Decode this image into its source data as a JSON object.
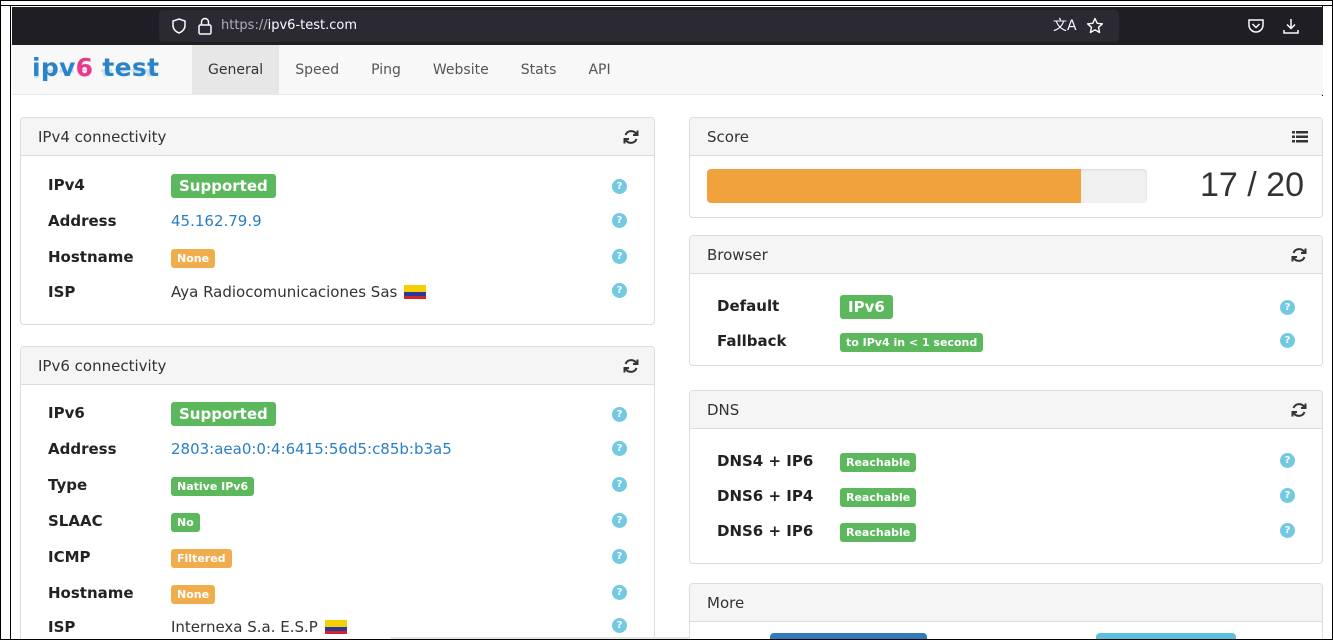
{
  "browser": {
    "url_scheme": "https://",
    "url_host": "ipv6-test.com"
  },
  "logo": {
    "part1": "ipv",
    "part2": "6",
    "part3": " test"
  },
  "nav": {
    "tabs": [
      {
        "label": "General"
      },
      {
        "label": "Speed"
      },
      {
        "label": "Ping"
      },
      {
        "label": "Website"
      },
      {
        "label": "Stats"
      },
      {
        "label": "API"
      }
    ]
  },
  "ipv4": {
    "title": "IPv4 connectivity",
    "rows": [
      {
        "label": "IPv4",
        "value": "Supported"
      },
      {
        "label": "Address",
        "value": "45.162.79.9"
      },
      {
        "label": "Hostname",
        "value": "None"
      },
      {
        "label": "ISP",
        "value": "Aya Radiocomunicaciones Sas"
      }
    ]
  },
  "ipv6": {
    "title": "IPv6 connectivity",
    "rows": [
      {
        "label": "IPv6",
        "value": "Supported"
      },
      {
        "label": "Address",
        "value": "2803:aea0:0:4:6415:56d5:c85b:b3a5"
      },
      {
        "label": "Type",
        "value": "Native IPv6"
      },
      {
        "label": "SLAAC",
        "value": "No"
      },
      {
        "label": "ICMP",
        "value": "Filtered"
      },
      {
        "label": "Hostname",
        "value": "None"
      },
      {
        "label": "ISP",
        "value": "Internexa S.a. E.S.P"
      }
    ]
  },
  "score": {
    "title": "Score",
    "text": "17 / 20",
    "fraction": 0.85
  },
  "browser_panel": {
    "title": "Browser",
    "rows": [
      {
        "label": "Default",
        "value": "IPv6"
      },
      {
        "label": "Fallback",
        "value": "to IPv4 in < 1 second"
      }
    ]
  },
  "dns": {
    "title": "DNS",
    "rows": [
      {
        "label": "DNS4 + IP6",
        "value": "Reachable"
      },
      {
        "label": "DNS6 + IP4",
        "value": "Reachable"
      },
      {
        "label": "DNS6 + IP6",
        "value": "Reachable"
      }
    ]
  },
  "more": {
    "title": "More"
  },
  "colors": {
    "success": "#5cb85c",
    "warning": "#f0ad4e",
    "link": "#2a7fc4",
    "progress": "#f0a33c",
    "logo_blue": "#2a84c9",
    "logo_pink": "#e9398c"
  }
}
